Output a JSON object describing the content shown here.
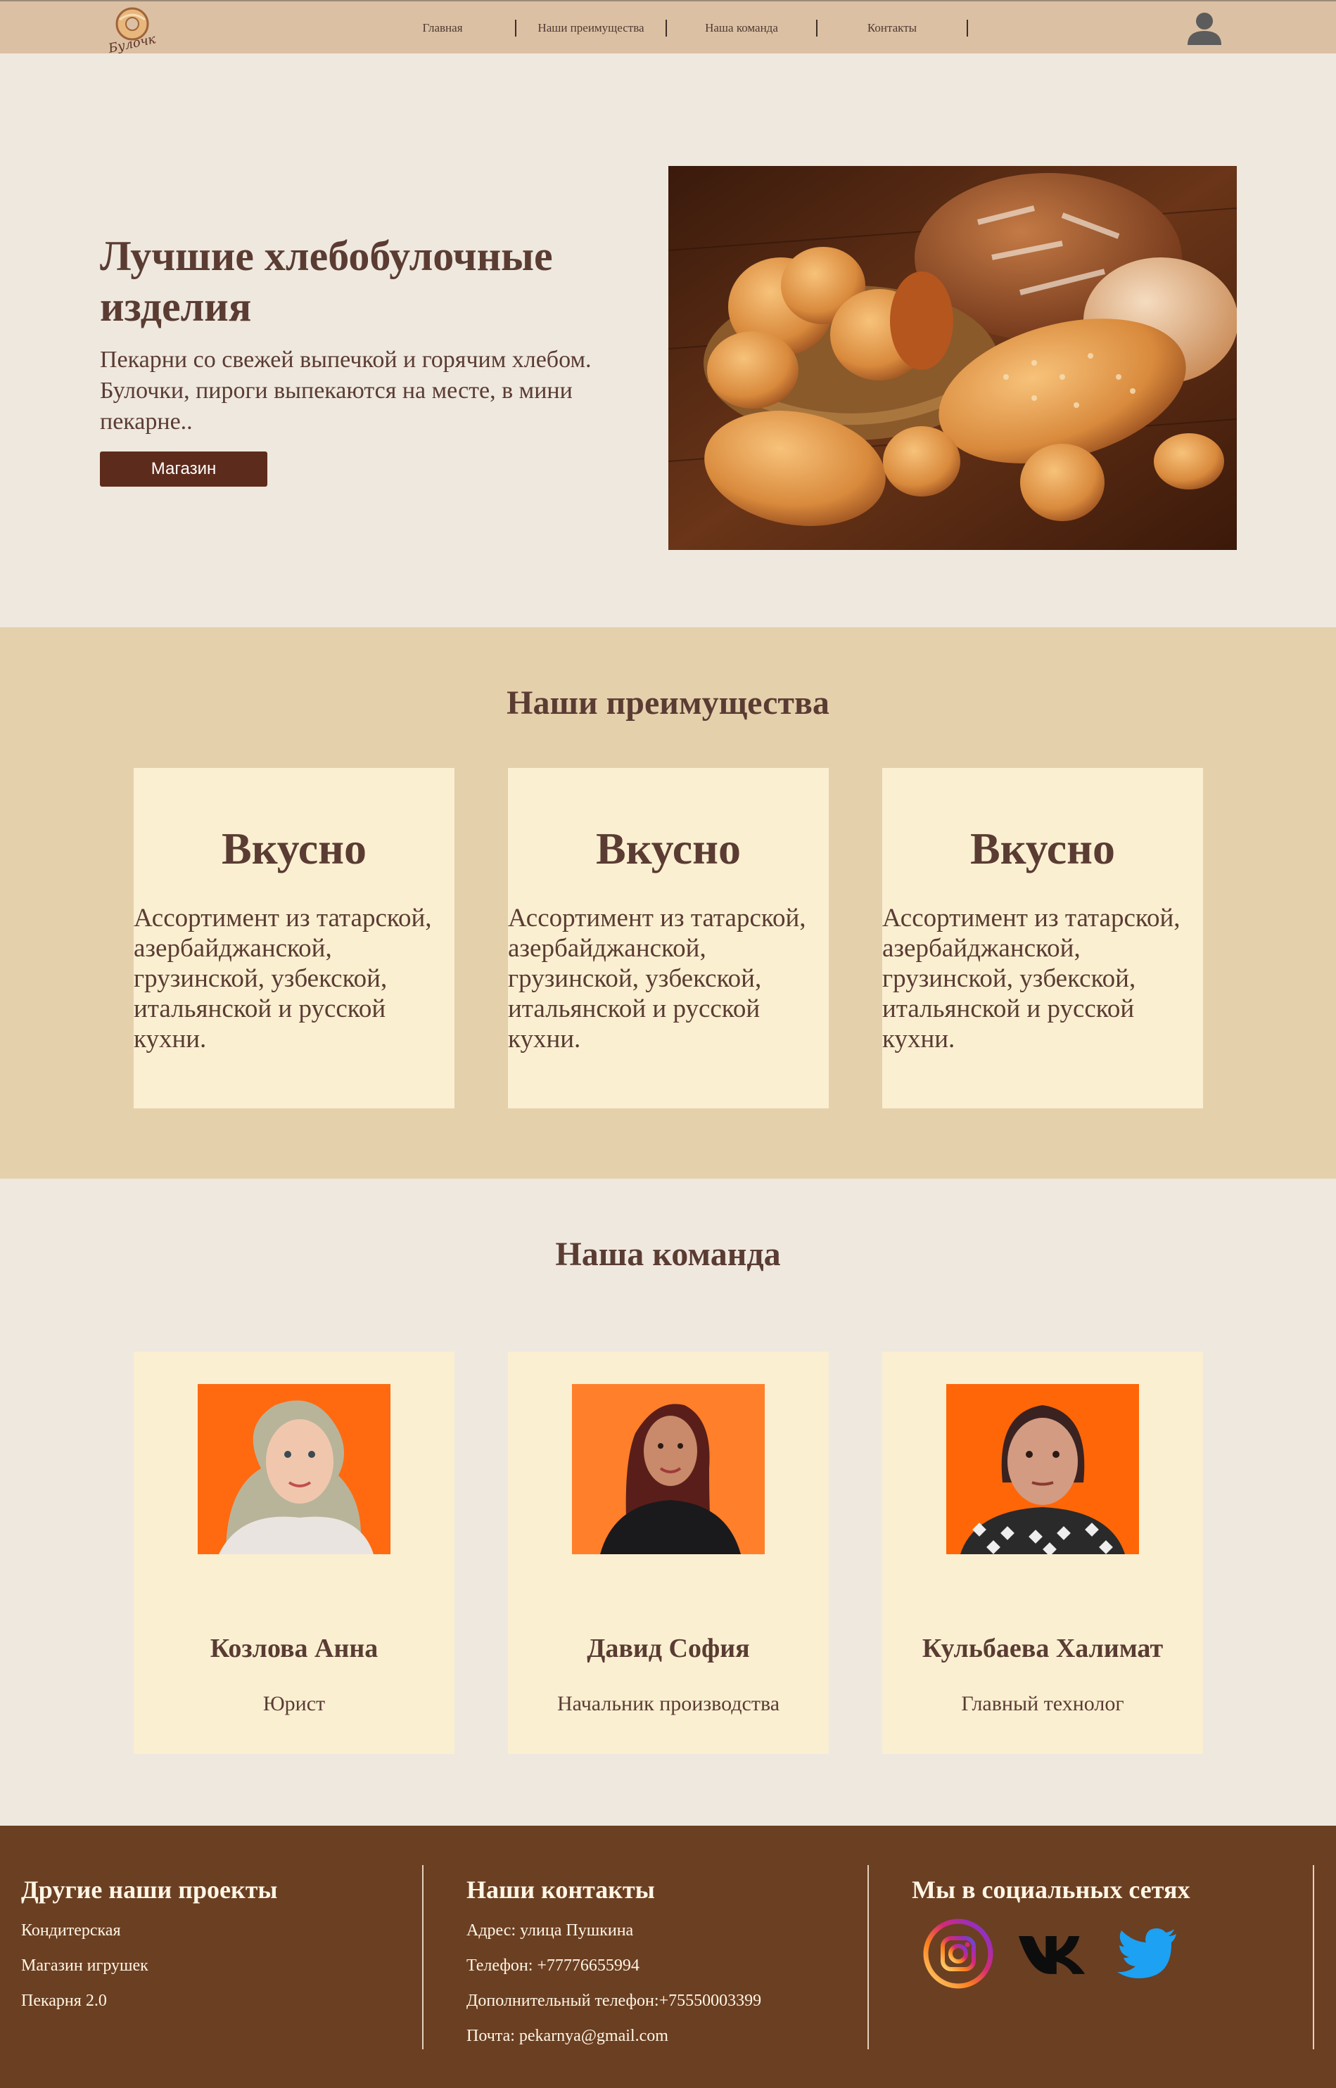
{
  "nav": {
    "logo_text": "Булочк",
    "links": [
      {
        "label": "Главная"
      },
      {
        "label": "Наши преимущества"
      },
      {
        "label": "Наша команда"
      },
      {
        "label": "Контакты"
      }
    ],
    "user_icon": "user-icon"
  },
  "hero": {
    "title": "Лучшие хлебобулочные изделия",
    "text": "Пекарни со свежей выпечкой и горячим хлебом. Булочки, пироги выпекаются на месте, в мини пекарне..",
    "button": "Магазин",
    "image": "bread-basket-photo"
  },
  "advantages": {
    "title": "Наши преимущества",
    "cards": [
      {
        "title": "Вкусно",
        "text": "Ассортимент из татарской, азербайджанской, грузинской, узбекской, итальянской и русской кухни."
      },
      {
        "title": "Вкусно",
        "text": "Ассортимент из татарской, азербайджанской, грузинской, узбекской, итальянской и русской кухни."
      },
      {
        "title": "Вкусно",
        "text": "Ассортимент из татарской, азербайджанской, грузинской, узбекской, итальянской и русской кухни."
      }
    ]
  },
  "team": {
    "title": "Наша команда",
    "members": [
      {
        "name": "Козлова Анна",
        "role": "Юрист"
      },
      {
        "name": "Давид София",
        "role": "Начальник производства"
      },
      {
        "name": "Кульбаева Халимат",
        "role": "Главный технолог"
      }
    ]
  },
  "footer": {
    "projects": {
      "title": "Другие наши проекты",
      "items": [
        "Кондитерская",
        "Магазин игрушек",
        "Пекарня 2.0"
      ]
    },
    "contacts": {
      "title": "Наши контакты",
      "items": [
        "Адрес: улица Пушкина",
        "Телефон: +77776655994",
        "Дополнительный телефон:+75550003399",
        "Почта: pekarnya@gmail.com"
      ]
    },
    "social": {
      "title": "Мы в социальных сетях",
      "icons": [
        "instagram-icon",
        "vk-icon",
        "twitter-icon"
      ]
    }
  },
  "colors": {
    "nav_bg": "#dcc0a3",
    "page_bg": "#efe8de",
    "advantages_bg": "#e5d0ac",
    "card_bg": "#fbefd2",
    "text": "#5a3c33",
    "button_bg": "#5d2b1c",
    "footer_bg": "#6b3f22"
  }
}
